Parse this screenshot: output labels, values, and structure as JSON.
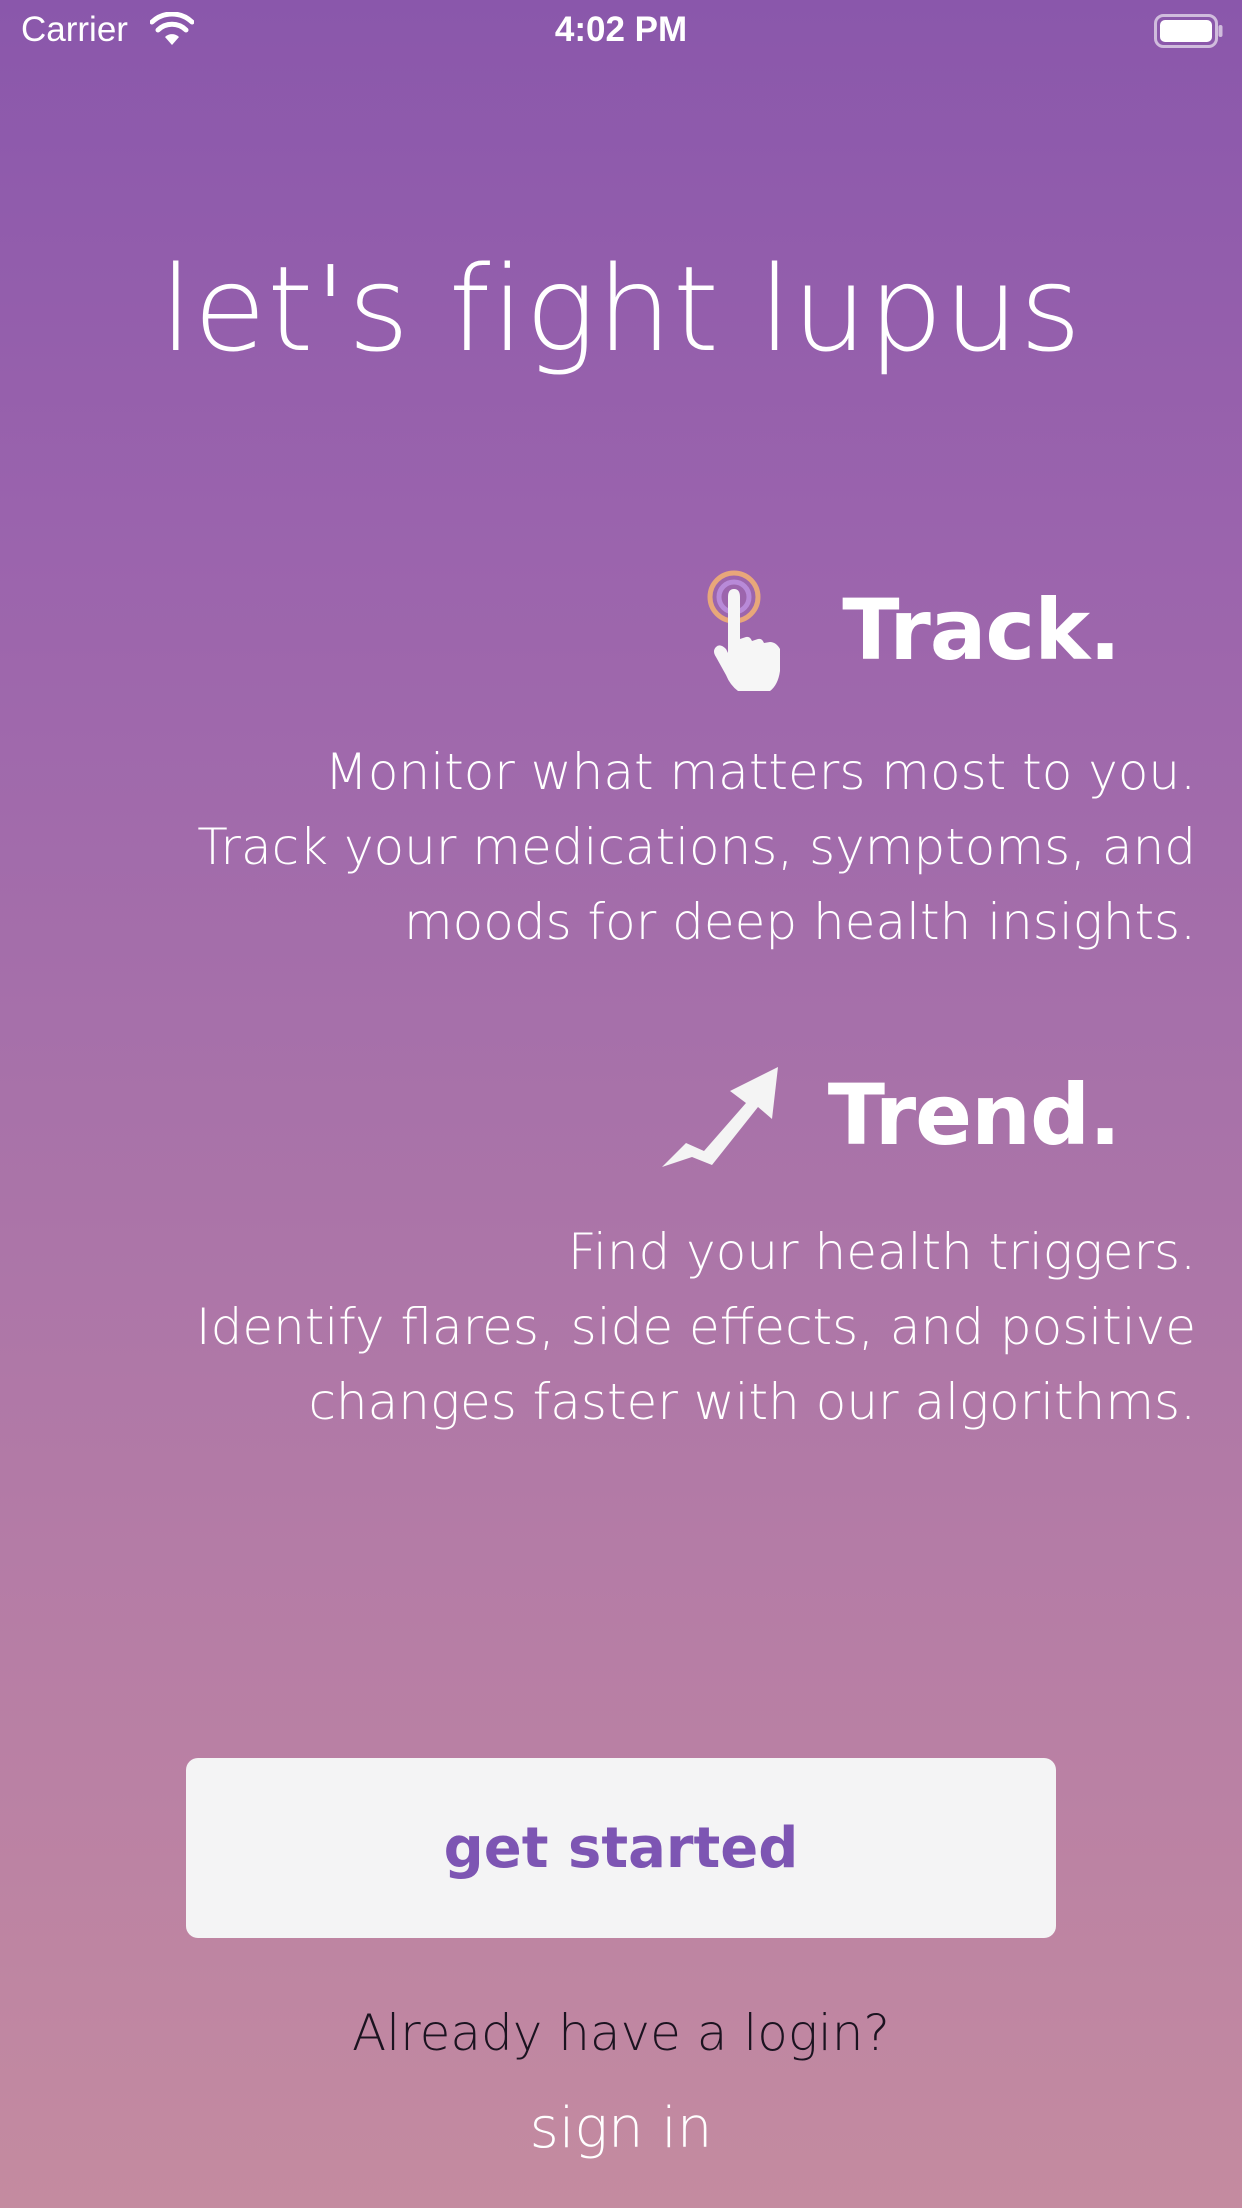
{
  "status_bar": {
    "carrier": "Carrier",
    "time": "4:02 PM",
    "wifi_icon": "wifi-icon",
    "battery_icon": "battery-icon"
  },
  "headline": "let's fight lupus",
  "features": [
    {
      "icon": "tap-hand-icon",
      "title": "Track.",
      "lines": [
        "Monitor what matters most to you.",
        "Track your medications, symptoms, and",
        "moods for deep health insights."
      ]
    },
    {
      "icon": "trend-arrow-icon",
      "title": "Trend.",
      "lines": [
        "Find your health triggers.",
        "Identify flares, side effects, and positive",
        "changes faster with our algorithms."
      ]
    }
  ],
  "cta": {
    "get_started_label": "get started",
    "login_prompt": "Already have a login?",
    "sign_in_label": "sign in"
  },
  "colors": {
    "gradient_top": "#8a57ab",
    "gradient_bottom": "#c48ba0",
    "button_background": "#f4f4f5",
    "button_text": "#7d55b3",
    "tap_ring_outer": "#e8a77a",
    "tap_ring_inner": "#b88ad8"
  }
}
